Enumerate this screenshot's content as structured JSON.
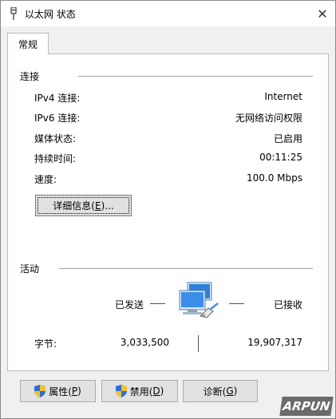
{
  "window": {
    "title": "以太网 状态",
    "close_glyph": "✕"
  },
  "tab": {
    "label": "常规"
  },
  "connection": {
    "title": "连接",
    "rows": [
      {
        "label": "IPv4 连接:",
        "value": "Internet"
      },
      {
        "label": "IPv6 连接:",
        "value": "无网络访问权限"
      },
      {
        "label": "媒体状态:",
        "value": "已启用"
      },
      {
        "label": "持续时间:",
        "value": "00:11:25"
      },
      {
        "label": "速度:",
        "value": "100.0 Mbps"
      }
    ],
    "details_button": {
      "text": "详细信息(",
      "key": "E",
      "suffix": ")..."
    }
  },
  "activity": {
    "title": "活动",
    "sent_label": "已发送",
    "received_label": "已接收",
    "bytes_label": "字节:",
    "bytes_sent": "3,033,500",
    "bytes_received": "19,907,317"
  },
  "buttons": {
    "properties": {
      "text": "属性(",
      "key": "P",
      "suffix": ")"
    },
    "disable": {
      "text": "禁用(",
      "key": "D",
      "suffix": ")"
    },
    "diagnose": {
      "text": "诊断(",
      "key": "G",
      "suffix": ")"
    }
  },
  "watermark": {
    "text": "ARPUN"
  },
  "icons": {
    "title": "ethernet-plug-icon",
    "network": "network-computer-icon",
    "shield": "uac-shield-icon"
  },
  "colors": {
    "window_bg": "#f0f0f0",
    "panel_bg": "#ffffff",
    "button_bg": "#e1e1e1",
    "monitor_blue": "#2f7fd8"
  }
}
